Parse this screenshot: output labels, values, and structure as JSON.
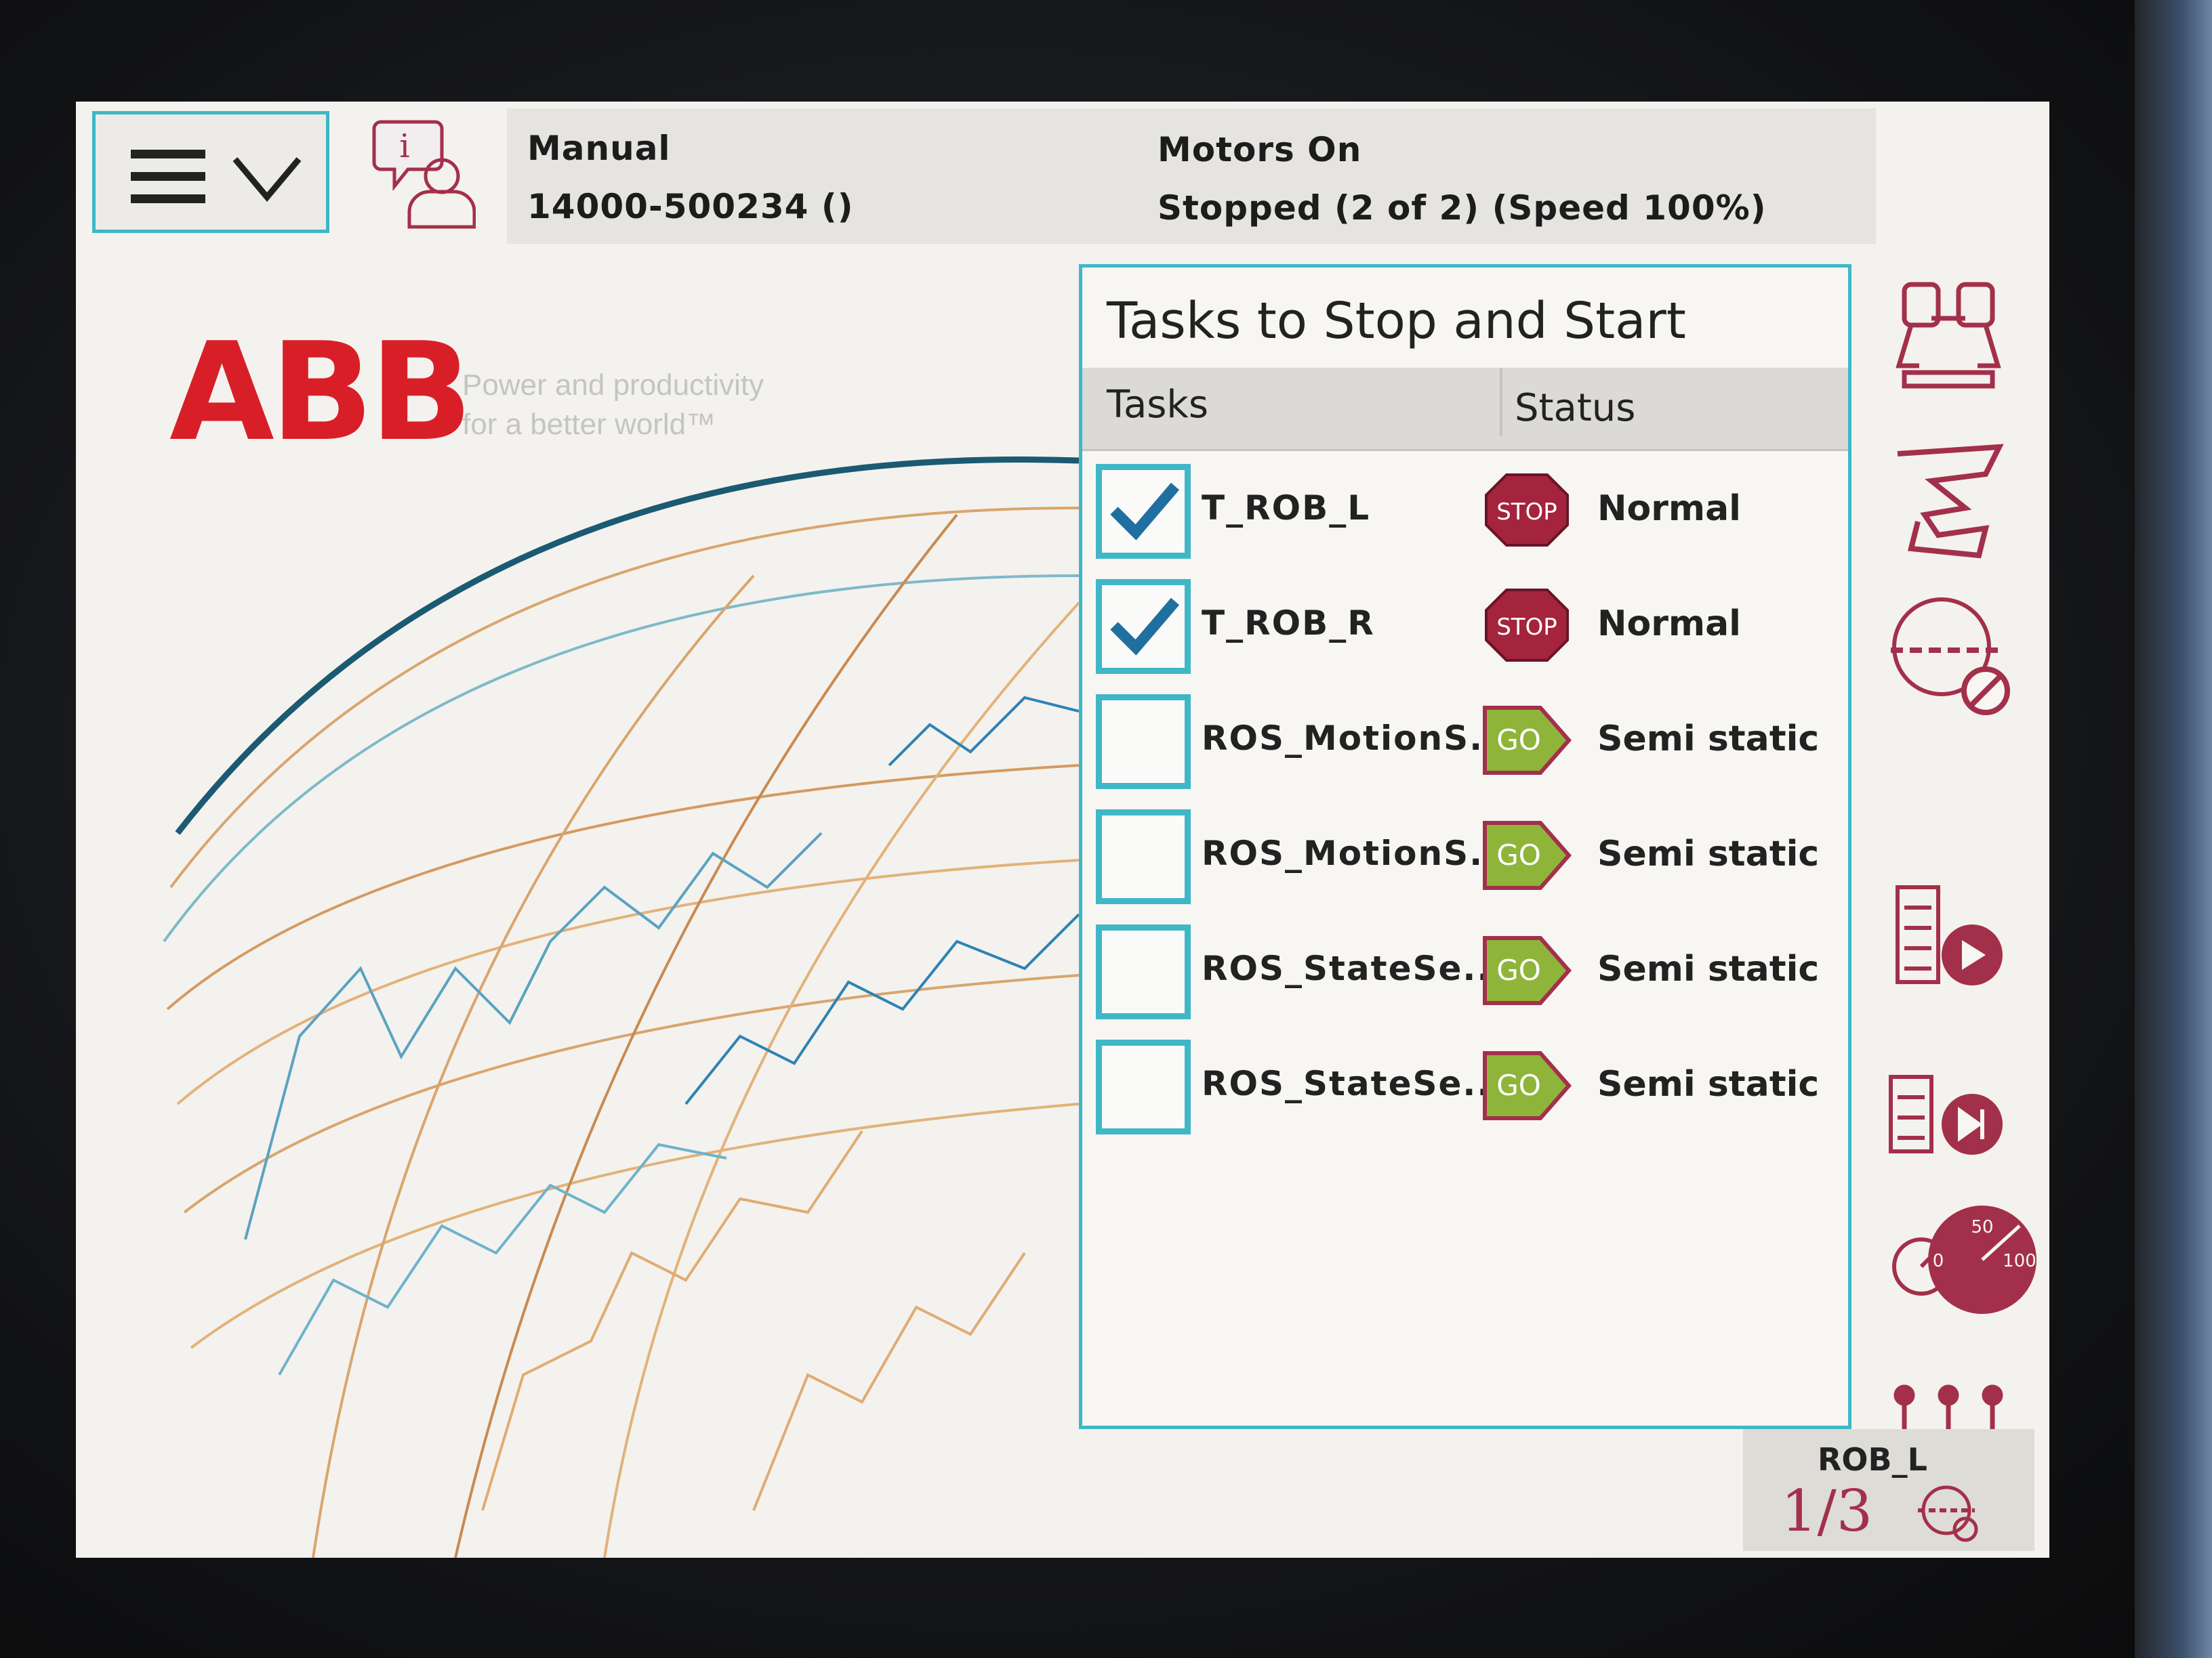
{
  "header": {
    "operating_mode": "Manual",
    "controller_id": "14000-500234 ()",
    "motors_state": "Motors On",
    "execution_state": "Stopped (2 of 2) (Speed 100%)"
  },
  "branding": {
    "logo_text": "ABB",
    "tagline_line1": "Power and productivity",
    "tagline_line2": "for a better world™"
  },
  "panel": {
    "title": "Tasks to Stop and Start",
    "columns": {
      "tasks": "Tasks",
      "status": "Status"
    },
    "rows": [
      {
        "name": "T_ROB_L",
        "checked": true,
        "status_icon": "stop-icon",
        "icon_text": "STOP",
        "status": "Normal"
      },
      {
        "name": "T_ROB_R",
        "checked": true,
        "status_icon": "stop-icon",
        "icon_text": "STOP",
        "status": "Normal"
      },
      {
        "name": "ROS_MotionS...",
        "checked": false,
        "status_icon": "go-icon",
        "icon_text": "GO",
        "status": "Semi static"
      },
      {
        "name": "ROS_MotionS...",
        "checked": false,
        "status_icon": "go-icon",
        "icon_text": "GO",
        "status": "Semi static"
      },
      {
        "name": "ROS_StateSe...",
        "checked": false,
        "status_icon": "go-icon",
        "icon_text": "GO",
        "status": "Semi static"
      },
      {
        "name": "ROS_StateSe...",
        "checked": false,
        "status_icon": "go-icon",
        "icon_text": "GO",
        "status": "Semi static"
      }
    ]
  },
  "sidebar": {
    "speed_gauge_labels": {
      "min": "0",
      "mid": "50",
      "max": "100"
    }
  },
  "robot_selector": {
    "robot": "ROB_L",
    "index_label": "1/3"
  },
  "colors": {
    "accent": "#3fb7c6",
    "stop_red": "#a3243c",
    "go_green": "#8fb43a",
    "icon_purple": "#a3304a",
    "brand_red": "#d81f27"
  }
}
